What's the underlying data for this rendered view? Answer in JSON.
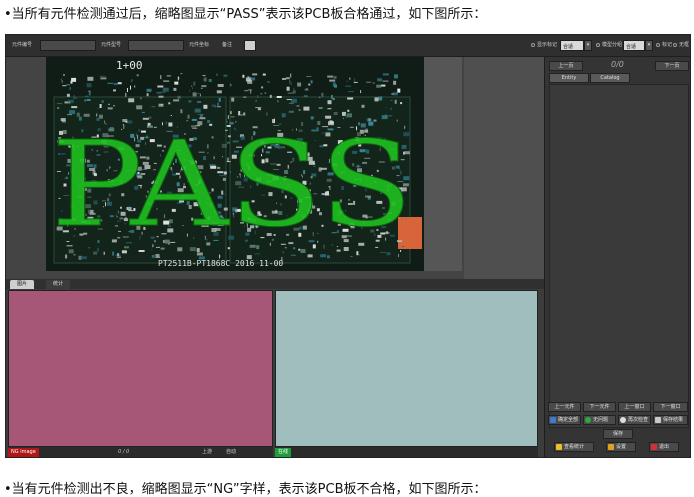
{
  "captions": {
    "top": "•当所有元件检测通过后，缩略图显示“PASS”表示该PCB板合格通过，如下图所示：",
    "bottom": "•当有元件检测出不良，缩略图显示“NG”字样，表示该PCB板不合格，如下图所示："
  },
  "toolbar": {
    "field1_label": "元件编号",
    "field2_label": "元件型号",
    "field3_label": "元件坐标",
    "mode_label": "备注",
    "display_label": "显示标记",
    "display_value": "合适",
    "window_label": "模型分组",
    "window_value": "合适",
    "radio1_label": "标记",
    "radio2_label": "无框"
  },
  "board": {
    "overlay_text": "PASS",
    "label_top": "1+00",
    "silkscreen": "PT2511B-PT1868C 2016 11-00"
  },
  "tabs": [
    "图片",
    "统计"
  ],
  "status": {
    "left_tag": "NG image",
    "left_counter": "0 / 0",
    "left_check1": "上游",
    "left_check2": "自动",
    "right_tag": "在线"
  },
  "right_panel": {
    "prev_label": "上一页",
    "next_label": "下一页",
    "counter": "0/0",
    "col1": "Entity",
    "col2": "Catalog",
    "nav_buttons": [
      "上一元件",
      "下一元件",
      "上一窗口",
      "下一窗口"
    ],
    "action_buttons": [
      "确定全部",
      "无问题",
      "再次检查",
      "保存结果"
    ],
    "save_label": "保存",
    "bottom_buttons": [
      "查看统计",
      "设置",
      "退出"
    ]
  },
  "colors": {
    "pass_green": "#1fbe1f",
    "pane_left": "#a65778",
    "pane_right": "#a0bebe",
    "ng_red": "#b01818",
    "online_green": "#1e9e3a"
  }
}
